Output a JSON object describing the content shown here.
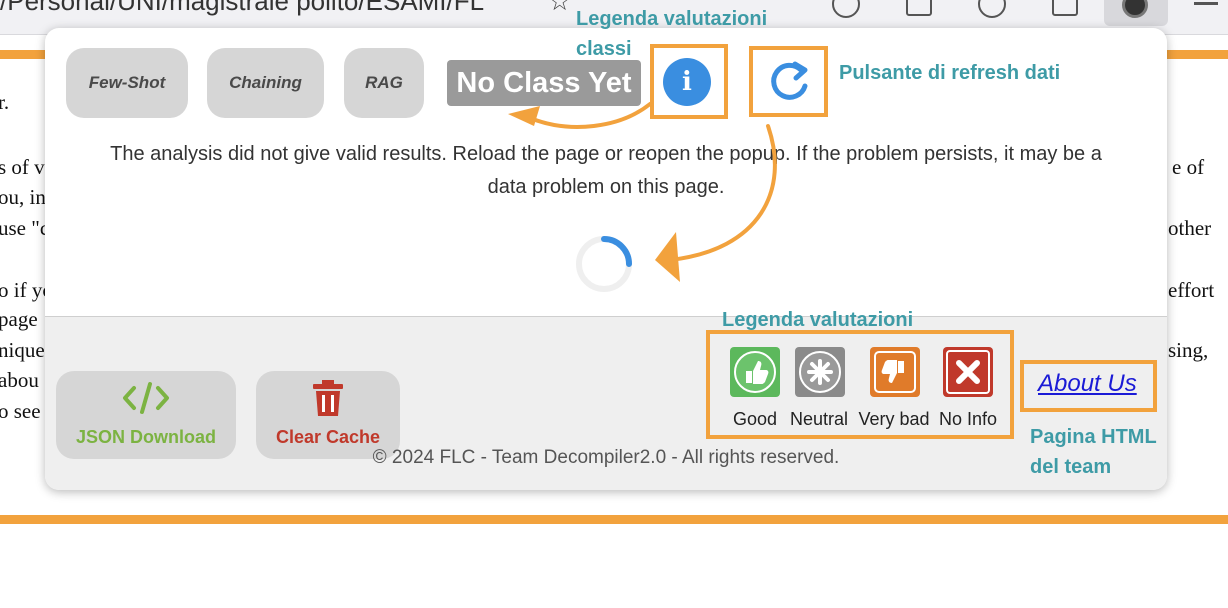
{
  "browser": {
    "url_fragment": "/Personal/UNI/magistrale polito/ESAMI/FL"
  },
  "background": {
    "lines": [
      "r.",
      "s of v",
      "ou, in",
      "use \"c",
      "o if yo",
      "page",
      "nique",
      "abou",
      "o see",
      "e of",
      "other",
      "effort",
      "sing,"
    ]
  },
  "popup": {
    "methods": [
      "Few-Shot",
      "Chaining",
      "RAG"
    ],
    "class_badge": "No Class Yet",
    "info_icon_glyph": "i",
    "message": "The analysis did not give valid results. Reload the page or reopen the popup. If the problem persists, it may be a data problem on this page.",
    "json_button": {
      "label": "JSON Download",
      "icon_glyph": "</>",
      "color": "#7cb342"
    },
    "cache_button": {
      "label": "Clear Cache",
      "color": "#c0392b"
    },
    "ratings": [
      {
        "label": "Good",
        "icon": "thumbs-up-icon",
        "color": "#5cb85c"
      },
      {
        "label": "Neutral",
        "icon": "asterisk-icon",
        "color": "#8a8a8a"
      },
      {
        "label": "Very bad",
        "icon": "thumbs-down-icon",
        "color": "#e07b2a"
      },
      {
        "label": "No Info",
        "icon": "x-icon",
        "color": "#c0392b"
      }
    ],
    "copyright": "© 2024 FLC - Team Decompiler2.0 - All rights reserved."
  },
  "annotations": {
    "legend_classes": [
      "Legenda valutazioni",
      "classi"
    ],
    "refresh": "Pulsante di refresh dati",
    "legend_ratings": "Legenda valutazioni",
    "team_page": [
      "Pagina HTML",
      "del team"
    ],
    "about_us": "About Us"
  },
  "colors": {
    "accent_orange": "#f2a23d",
    "annotation_teal": "#3e9ba6",
    "info_blue": "#3a8ee0"
  }
}
